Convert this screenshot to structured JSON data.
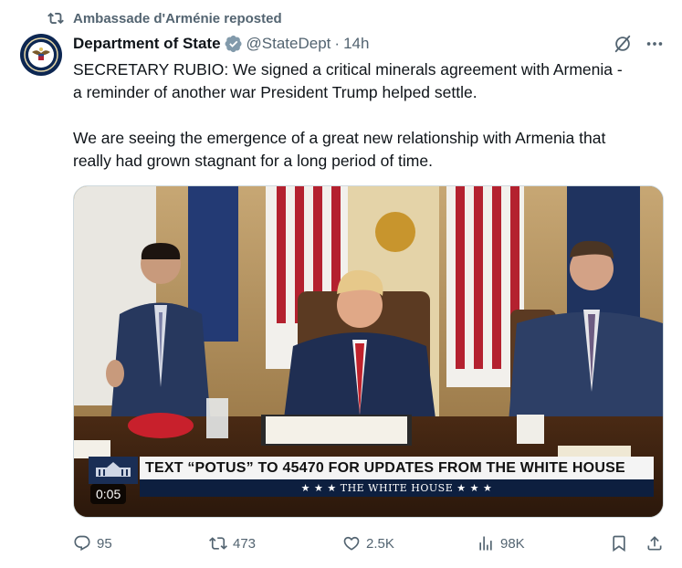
{
  "repost": {
    "label": "Ambassade d'Arménie reposted"
  },
  "author": {
    "name": "Department of State",
    "handle": "@StateDept",
    "separator": "·",
    "time": "14h"
  },
  "tweet": {
    "paragraph1": "SECRETARY RUBIO: We signed a critical minerals agreement with Armenia -\na reminder of another war President Trump helped settle.",
    "paragraph2": "We are seeing the emergence of a great new relationship with Armenia that\nreally had grown stagnant for a long period of time."
  },
  "video": {
    "chyron_main": "TEXT “POTUS” TO 45470 FOR UPDATES FROM THE WHITE HOUSE",
    "chyron_sub": "★ ★ ★   THE WHITE HOUSE   ★ ★ ★",
    "duration": "0:05"
  },
  "actions": {
    "replies": "95",
    "reposts": "473",
    "likes": "2.5K",
    "views": "98K"
  },
  "colors": {
    "muted": "#536471",
    "verified": "#829aab",
    "chyron_navy": "#0d1f3f"
  }
}
